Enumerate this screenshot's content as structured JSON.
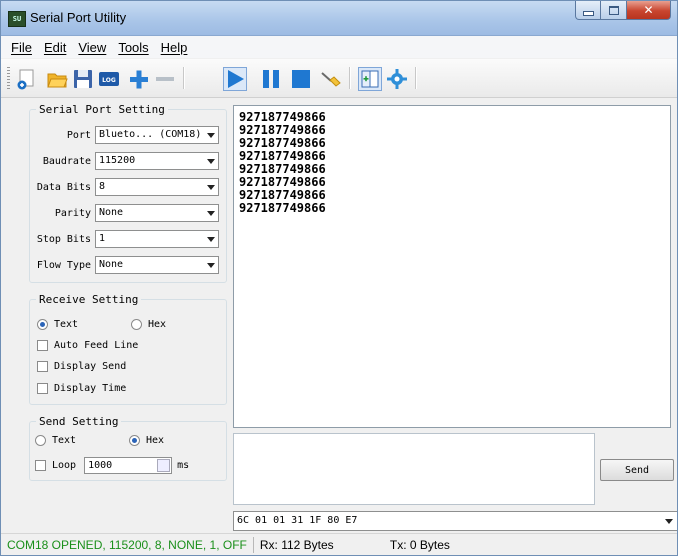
{
  "window": {
    "title": "Serial Port Utility",
    "app_icon_text": "SU"
  },
  "menu": {
    "items": [
      "File",
      "Edit",
      "View",
      "Tools",
      "Help"
    ]
  },
  "toolbar": {
    "icons": [
      "new-connection-icon",
      "open-icon",
      "save-icon",
      "log-icon",
      "add-icon",
      "remove-icon",
      "start-icon",
      "pause-icon",
      "stop-icon",
      "clear-icon",
      "view-mode-icon",
      "settings-icon"
    ],
    "log_label": "LOG"
  },
  "serial_port_setting": {
    "title": "Serial Port Setting",
    "port_label": "Port",
    "port_value": "Blueto... (COM18)",
    "baudrate_label": "Baudrate",
    "baudrate_value": "115200",
    "databits_label": "Data Bits",
    "databits_value": "8",
    "parity_label": "Parity",
    "parity_value": "None",
    "stopbits_label": "Stop Bits",
    "stopbits_value": "1",
    "flowtype_label": "Flow Type",
    "flowtype_value": "None"
  },
  "receive_setting": {
    "title": "Receive Setting",
    "text_label": "Text",
    "hex_label": "Hex",
    "selected": "Text",
    "auto_feed_line": "Auto Feed Line",
    "display_send": "Display Send",
    "display_time": "Display Time"
  },
  "send_setting": {
    "title": "Send Setting",
    "text_label": "Text",
    "hex_label": "Hex",
    "selected": "Hex",
    "loop_label": "Loop",
    "loop_value": "1000",
    "unit": "ms"
  },
  "receive_area": {
    "lines": [
      "927187749866",
      "927187749866",
      "927187749866",
      "927187749866",
      "927187749866",
      "927187749866",
      "927187749866",
      "927187749866"
    ]
  },
  "send": {
    "button_label": "Send",
    "history_value": "6C 01 01 31 1F 80 E7"
  },
  "status": {
    "connection": "COM18 OPENED, 115200, 8, NONE, 1, OFF",
    "rx": "Rx: 112 Bytes",
    "tx": "Tx: 0 Bytes",
    "connection_color": "#1a8f1a"
  }
}
